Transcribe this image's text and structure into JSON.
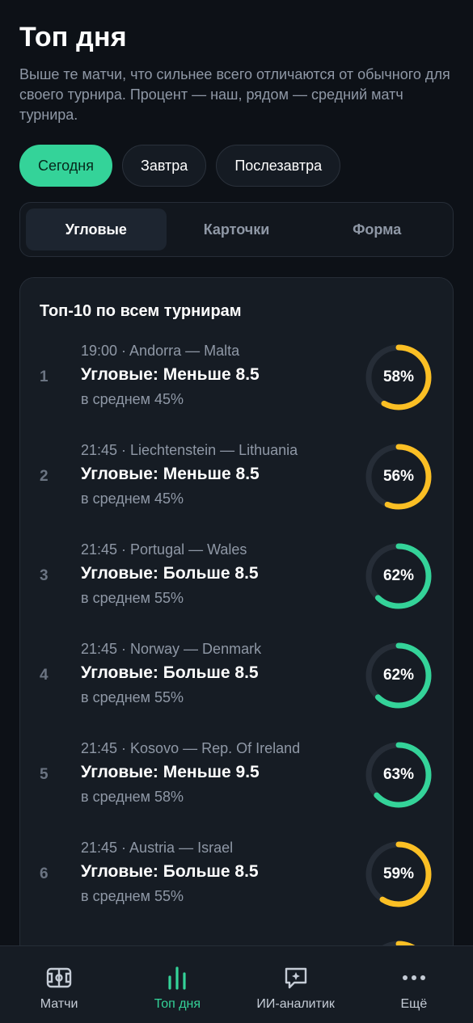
{
  "header": {
    "title": "Топ дня",
    "subtitle": "Выше те матчи, что сильнее всего отличаются от обычного для своего турнира. Процент — наш, рядом — средний матч турнира."
  },
  "day_tabs": [
    {
      "label": "Сегодня",
      "active": true
    },
    {
      "label": "Завтра",
      "active": false
    },
    {
      "label": "Послезавтра",
      "active": false
    }
  ],
  "market_tabs": [
    {
      "label": "Угловые",
      "active": true
    },
    {
      "label": "Карточки",
      "active": false
    },
    {
      "label": "Форма",
      "active": false
    }
  ],
  "card": {
    "title": "Топ-10 по всем турнирам",
    "rows": [
      {
        "rank": "1",
        "match": "19:00 · Andorra — Malta",
        "market": "Угловые: Меньше 8.5",
        "avg": "в среднем 45%",
        "pct_label": "58%",
        "pct": 58,
        "color": "#fbbf24"
      },
      {
        "rank": "2",
        "match": "21:45 · Liechtenstein — Lithuania",
        "market": "Угловые: Меньше 8.5",
        "avg": "в среднем 45%",
        "pct_label": "56%",
        "pct": 56,
        "color": "#fbbf24"
      },
      {
        "rank": "3",
        "match": "21:45 · Portugal — Wales",
        "market": "Угловые: Больше 8.5",
        "avg": "в среднем 55%",
        "pct_label": "62%",
        "pct": 62,
        "color": "#34d399"
      },
      {
        "rank": "4",
        "match": "21:45 · Norway — Denmark",
        "market": "Угловые: Больше 8.5",
        "avg": "в среднем 55%",
        "pct_label": "62%",
        "pct": 62,
        "color": "#34d399"
      },
      {
        "rank": "5",
        "match": "21:45 · Kosovo — Rep. Of Ireland",
        "market": "Угловые: Меньше 9.5",
        "avg": "в среднем 58%",
        "pct_label": "63%",
        "pct": 63,
        "color": "#34d399"
      },
      {
        "rank": "6",
        "match": "21:45 · Austria — Israel",
        "market": "Угловые: Больше 8.5",
        "avg": "в среднем 55%",
        "pct_label": "59%",
        "pct": 59,
        "color": "#fbbf24"
      },
      {
        "rank": "",
        "match": "",
        "market": "",
        "avg": "",
        "pct_label": "",
        "pct": 55,
        "color": "#fbbf24"
      }
    ]
  },
  "colors": {
    "accent": "#34d399",
    "warning": "#fbbf24",
    "ring_track": "#262d37"
  },
  "nav": [
    {
      "label": "Матчи",
      "icon": "football-field-icon",
      "active": false
    },
    {
      "label": "Топ дня",
      "icon": "bar-chart-icon",
      "active": true
    },
    {
      "label": "ИИ-аналитик",
      "icon": "ai-chat-icon",
      "active": false
    },
    {
      "label": "Ещё",
      "icon": "more-dots-icon",
      "active": false
    }
  ]
}
